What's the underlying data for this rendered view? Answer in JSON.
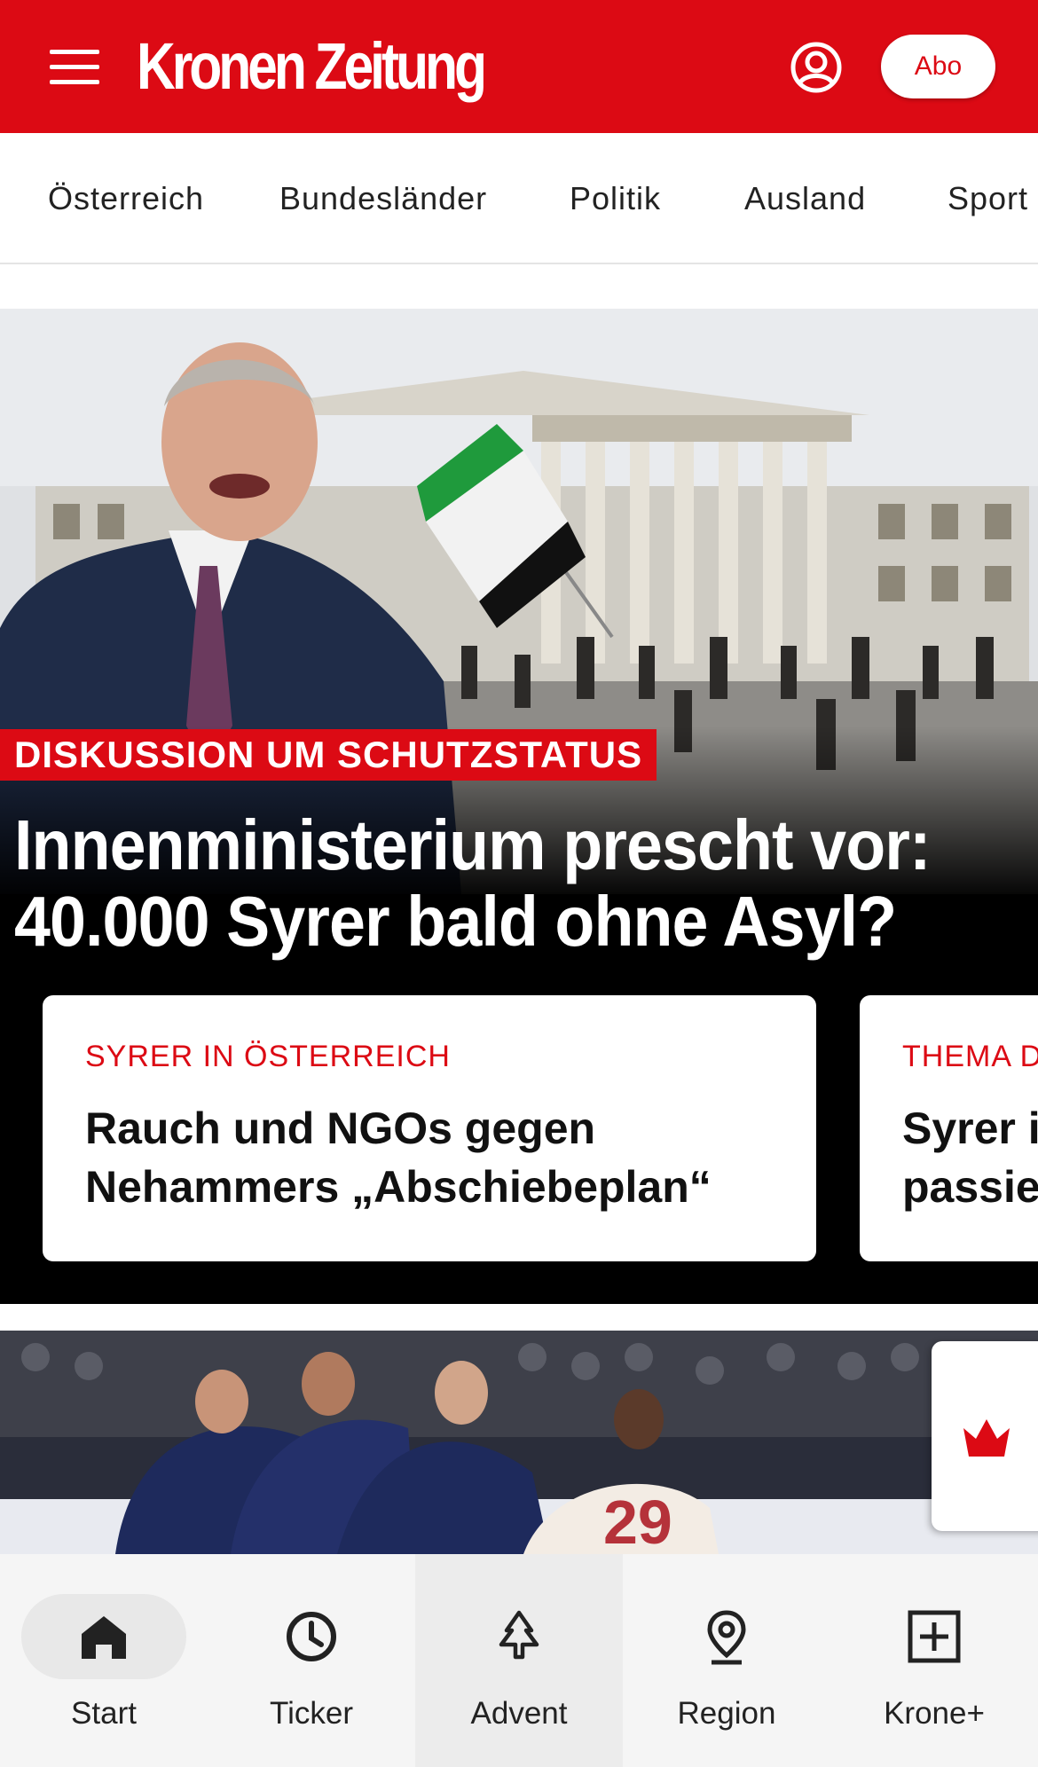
{
  "header": {
    "logo": "Kronen Zeitung",
    "abo_label": "Abo",
    "menu_icon": "hamburger-icon",
    "account_icon": "account-circle-icon",
    "brand_color": "#dc0a14"
  },
  "nav": {
    "items": [
      "Österreich",
      "Bundesländer",
      "Politik",
      "Ausland",
      "Sport"
    ]
  },
  "hero": {
    "kicker": "DISKUSSION UM SCHUTZSTATUS",
    "headline": "Innenministerium prescht vor: 40.000 Syrer bald ohne Asyl?",
    "cards": [
      {
        "kicker": "SYRER IN ÖSTERREICH",
        "title_line1": "Rauch und NGOs gegen",
        "title_line2": "Nehammers „Abschiebeplan“"
      },
      {
        "kicker": "THEMA D",
        "title_line1": "Syrer i",
        "title_line2": "passie"
      }
    ]
  },
  "bottom_nav": {
    "tabs": [
      {
        "label": "Start",
        "icon": "home-icon"
      },
      {
        "label": "Ticker",
        "icon": "clock-icon"
      },
      {
        "label": "Advent",
        "icon": "tree-icon"
      },
      {
        "label": "Region",
        "icon": "location-pin-icon"
      },
      {
        "label": "Krone+",
        "icon": "plus-box-icon"
      }
    ]
  }
}
